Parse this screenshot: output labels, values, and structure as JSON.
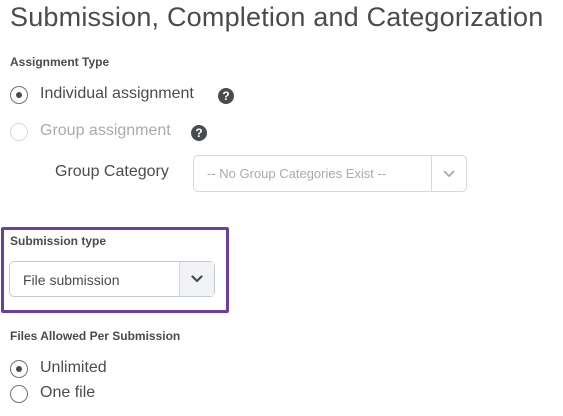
{
  "page_title": "Submission, Completion and Categorization",
  "assignment_type": {
    "label": "Assignment Type",
    "options": [
      {
        "label": "Individual assignment",
        "selected": true,
        "disabled": false,
        "help_icon": "question-circle-icon"
      },
      {
        "label": "Group assignment",
        "selected": false,
        "disabled": true,
        "help_icon": "question-circle-icon"
      }
    ],
    "help_glyph": "?"
  },
  "group_category": {
    "label": "Group Category",
    "value": "-- No Group Categories Exist --",
    "disabled": true
  },
  "submission_type": {
    "label": "Submission type",
    "value": "File submission",
    "highlight_color": "#6b3fa0"
  },
  "files_allowed": {
    "label": "Files Allowed Per Submission",
    "options": [
      {
        "label": "Unlimited",
        "selected": true
      },
      {
        "label": "One file",
        "selected": false
      }
    ]
  }
}
